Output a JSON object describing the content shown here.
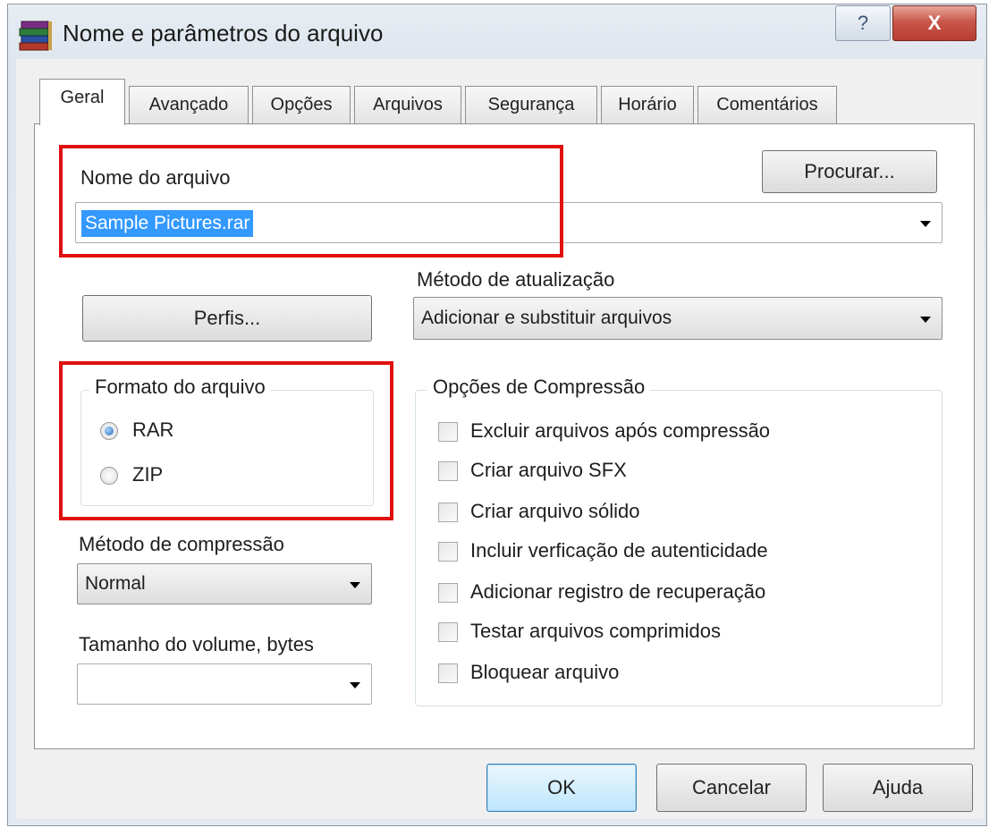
{
  "window": {
    "title": "Nome e parâmetros do arquivo",
    "help_label": "?",
    "close_label": "X"
  },
  "tabs": [
    {
      "label": "Geral"
    },
    {
      "label": "Avançado"
    },
    {
      "label": "Opções"
    },
    {
      "label": "Arquivos"
    },
    {
      "label": "Segurança"
    },
    {
      "label": "Horário"
    },
    {
      "label": "Comentários"
    }
  ],
  "general": {
    "filename_label": "Nome do arquivo",
    "filename_value": "Sample Pictures.rar",
    "browse_button": "Procurar...",
    "update_method_label": "Método de atualização",
    "update_method_value": "Adicionar e substituir arquivos",
    "profiles_button": "Perfis...",
    "archive_format": {
      "label": "Formato do arquivo",
      "options": [
        {
          "label": "RAR",
          "selected": true
        },
        {
          "label": "ZIP",
          "selected": false
        }
      ]
    },
    "compression_method_label": "Método de compressão",
    "compression_method_value": "Normal",
    "volume_size_label": "Tamanho do volume, bytes",
    "volume_size_value": "",
    "compression_options": {
      "label": "Opções de Compressão",
      "items": [
        {
          "label": "Excluir arquivos após compressão",
          "checked": false
        },
        {
          "label": "Criar arquivo SFX",
          "checked": false
        },
        {
          "label": "Criar arquivo sólido",
          "checked": false
        },
        {
          "label": "Incluir verficação de autenticidade",
          "checked": false
        },
        {
          "label": "Adicionar registro de recuperação",
          "checked": false
        },
        {
          "label": "Testar arquivos comprimidos",
          "checked": false
        },
        {
          "label": "Bloquear arquivo",
          "checked": false
        }
      ]
    }
  },
  "footer": {
    "ok": "OK",
    "cancel": "Cancelar",
    "help": "Ajuda"
  },
  "colors": {
    "highlight_box": "#e01010",
    "selection": "#3399ff",
    "close_button": "#c9574a"
  },
  "icons": {
    "app": "winrar-books-icon",
    "dropdown": "chevron-down-icon"
  }
}
